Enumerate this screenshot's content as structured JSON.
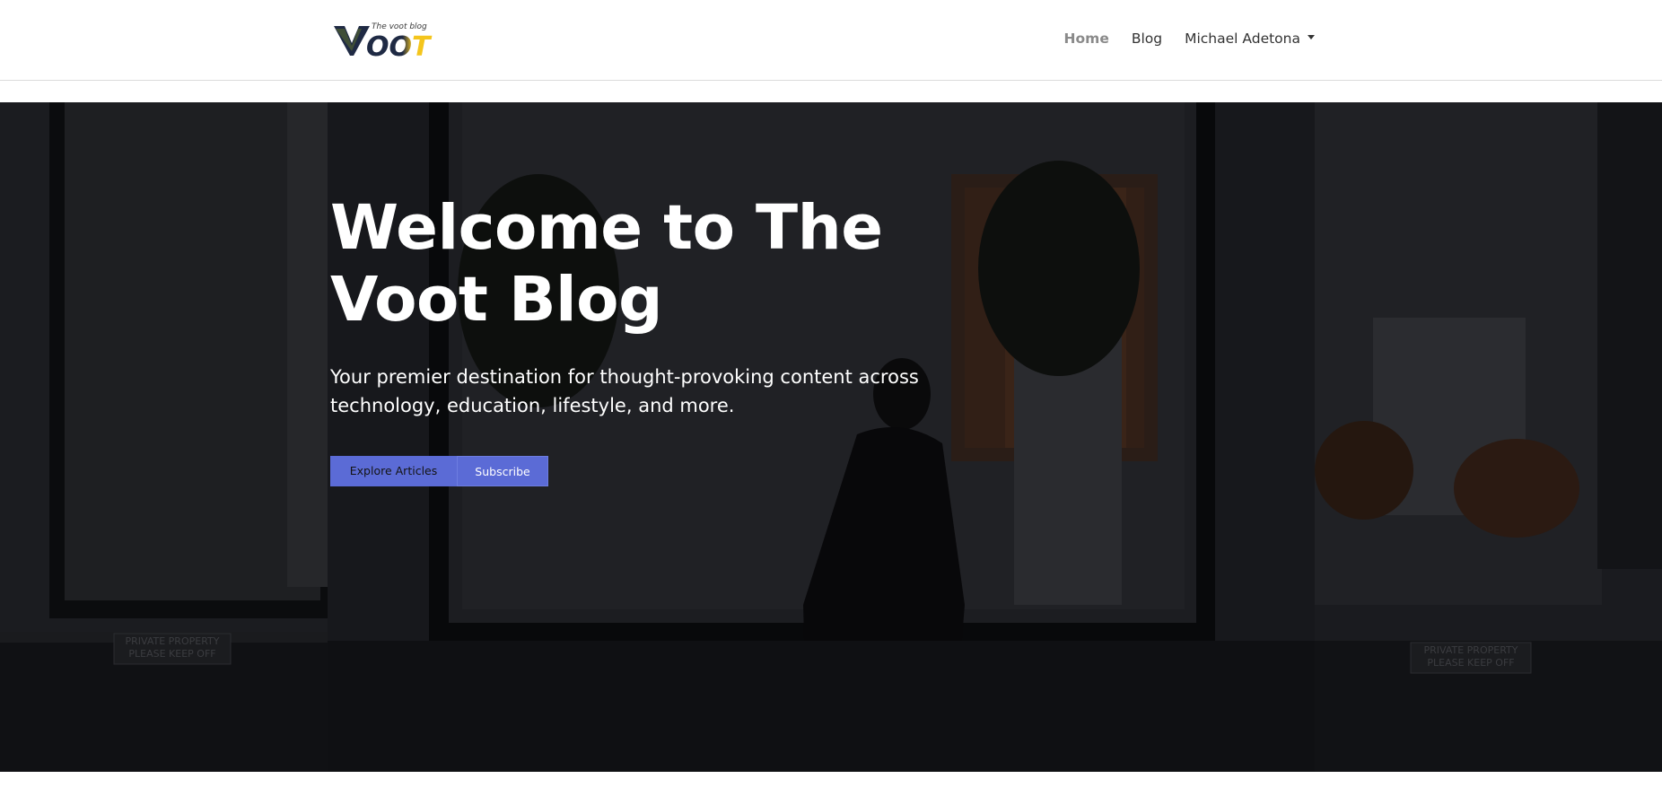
{
  "header": {
    "logo": {
      "text": "VOOT",
      "tagline": "The voot blog"
    },
    "nav": {
      "items": [
        {
          "label": "Home",
          "active": true
        },
        {
          "label": "Blog",
          "active": false
        }
      ],
      "user_menu_label": "Michael Adetona"
    }
  },
  "hero": {
    "title": "Welcome to The Voot Blog",
    "subtitle": "Your premier destination for thought-provoking content across technology, education, lifestyle, and more.",
    "buttons": {
      "explore_label": "Explore Articles",
      "subscribe_label": "Subscribe"
    },
    "background_signs": [
      "PRIVATE PROPERTY",
      "PLEASE KEEP OFF"
    ]
  },
  "colors": {
    "accent": "#5b6bd6",
    "hero_overlay": "#15161a",
    "logo_yellow": "#f4c51c",
    "logo_navy": "#1f2a44"
  }
}
